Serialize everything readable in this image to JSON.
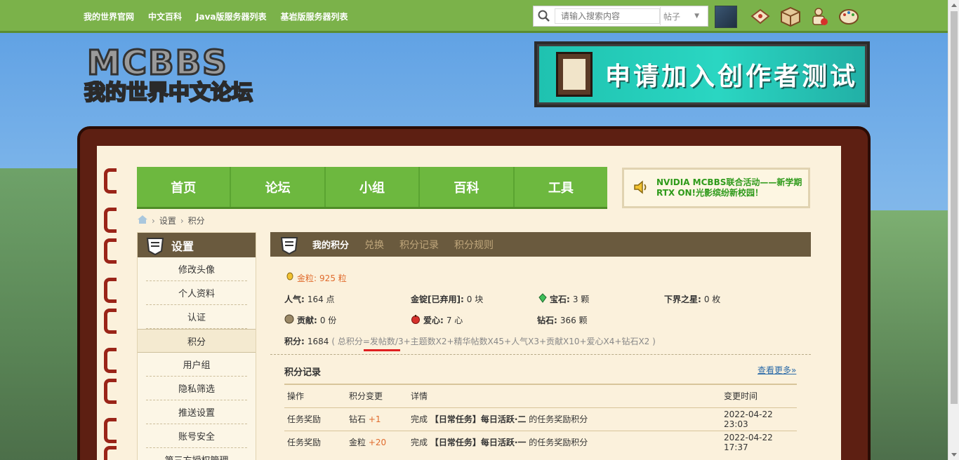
{
  "topbar": {
    "links": [
      "我的世界官网",
      "中文百科",
      "Java版服务器列表",
      "基岩版服务器列表"
    ],
    "search_placeholder": "请输入搜索内容",
    "search_type": "帖子"
  },
  "banner": {
    "text": "申请加入创作者测试"
  },
  "nav": [
    "首页",
    "论坛",
    "小组",
    "百科",
    "工具"
  ],
  "notice": {
    "text": "NVIDIA MCBBS联合活动——新学期RTX ON!光影缤纷新校园！"
  },
  "breadcrumb": {
    "item1": "设置",
    "item2": "积分"
  },
  "sidebar": {
    "title": "设置",
    "items": [
      "修改头像",
      "个人资料",
      "认证",
      "积分",
      "用户组",
      "隐私筛选",
      "推送设置",
      "账号安全",
      "第三方授权管理"
    ]
  },
  "tabs": {
    "current": "我的积分",
    "t2": "兑换",
    "t3": "积分记录",
    "t4": "积分规则"
  },
  "stats": {
    "gold_label": "金粒:",
    "gold_value": "925 粒",
    "popularity_label": "人气:",
    "popularity_value": "164 点",
    "ingot_label": "金锭[已弃用]:",
    "ingot_value": "0 块",
    "gem_label": "宝石:",
    "gem_value": "3 颗",
    "nether_label": "下界之星:",
    "nether_value": "0 枚",
    "contrib_label": "贡献:",
    "contrib_value": "0 份",
    "love_label": "爱心:",
    "love_value": "7 心",
    "diamond_label": "钻石:",
    "diamond_value": "366 颗",
    "total_label": "积分:",
    "total_value": "1684",
    "formula": "( 总积分=发帖数/3+主题数X2+精华帖数X45+人气X3+贡献X10+爱心X4+钻石X2 )"
  },
  "records": {
    "title": "积分记录",
    "more": "查看更多»",
    "headers": [
      "操作",
      "积分变更",
      "详情",
      "变更时间"
    ],
    "rows": [
      {
        "op": "任务奖励",
        "item": "钻石",
        "delta": "+1",
        "pre": "完成",
        "task": "【日常任务】每日活跃·二",
        "post": "的任务奖励积分",
        "time": "2022-04-22 23:03"
      },
      {
        "op": "任务奖励",
        "item": "金粒",
        "delta": "+20",
        "pre": "完成",
        "task": "【日常任务】每日活跃·一",
        "post": "的任务奖励积分",
        "time": "2022-04-22 17:37"
      }
    ]
  },
  "colors": {
    "nav_green": "#6db83f",
    "header_brown": "#6a5a3e",
    "accent_orange": "#e06b2d"
  }
}
